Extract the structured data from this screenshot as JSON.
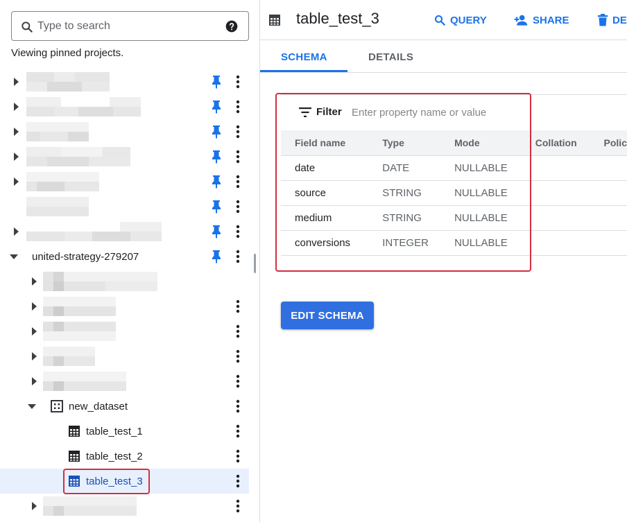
{
  "explorer": {
    "search_placeholder": "Type to search",
    "viewing_text": "Viewing pinned projects.",
    "project_name": "united-strategy-279207",
    "dataset_name": "new_dataset",
    "tables": [
      {
        "label": "table_test_1"
      },
      {
        "label": "table_test_2"
      },
      {
        "label": "table_test_3"
      }
    ]
  },
  "header": {
    "title": "table_test_3",
    "query_label": "QUERY",
    "share_label": "SHARE",
    "delete_label": "DE"
  },
  "tabs": {
    "schema": "SCHEMA",
    "details": "DETAILS"
  },
  "filter": {
    "label": "Filter",
    "placeholder": "Enter property name or value"
  },
  "schema": {
    "columns": [
      "Field name",
      "Type",
      "Mode",
      "Collation",
      "Polic"
    ],
    "rows": [
      {
        "name": "date",
        "type": "DATE",
        "mode": "NULLABLE"
      },
      {
        "name": "source",
        "type": "STRING",
        "mode": "NULLABLE"
      },
      {
        "name": "medium",
        "type": "STRING",
        "mode": "NULLABLE"
      },
      {
        "name": "conversions",
        "type": "INTEGER",
        "mode": "NULLABLE"
      }
    ]
  },
  "edit_schema_label": "EDIT SCHEMA",
  "colors": {
    "accent": "#1a73e8",
    "pin": "#1a73e8",
    "highlight_outline": "#d32f3f",
    "selected_row": "#e8f0fe",
    "primary_button": "#2f6fe0"
  }
}
